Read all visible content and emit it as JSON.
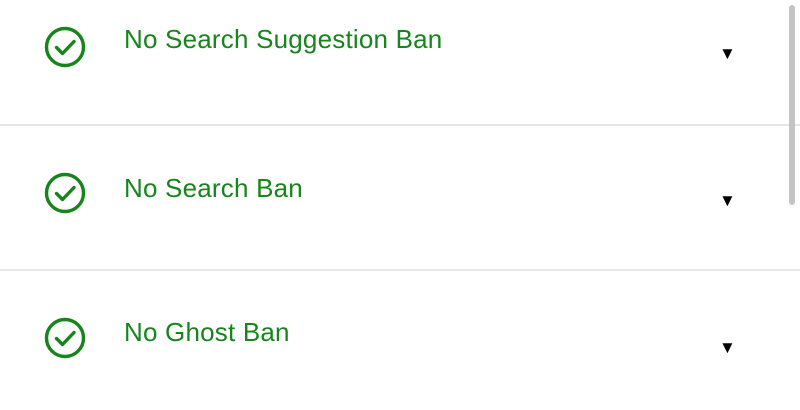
{
  "colors": {
    "success_green": "#17841c",
    "caret": "#000000",
    "divider": "#e6e6e8",
    "scrollbar": "#c4c4c6"
  },
  "results": [
    {
      "status_icon": "check-circle-icon",
      "label": "No Search Suggestion Ban",
      "toggle_icon": "caret-down-icon",
      "toggle_glyph": "▼"
    },
    {
      "status_icon": "check-circle-icon",
      "label": "No Search Ban",
      "toggle_icon": "caret-down-icon",
      "toggle_glyph": "▼"
    },
    {
      "status_icon": "check-circle-icon",
      "label": "No Ghost Ban",
      "toggle_icon": "caret-down-icon",
      "toggle_glyph": "▼"
    }
  ]
}
